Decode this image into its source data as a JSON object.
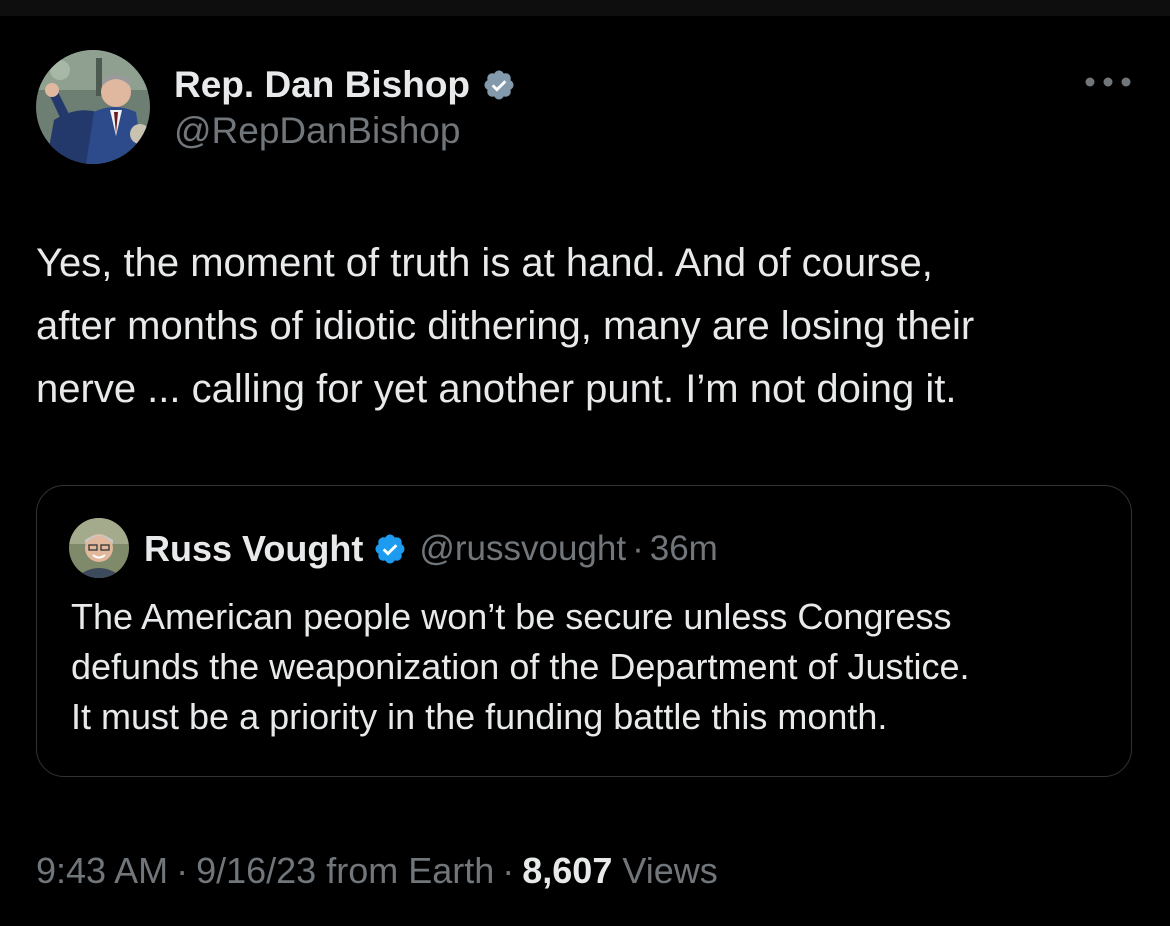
{
  "author": {
    "name": "Rep. Dan Bishop",
    "handle": "@RepDanBishop",
    "verified_badge": "gray-verified-badge-icon",
    "badge_color": "#829aab"
  },
  "tweet": {
    "text": "Yes, the moment of truth is at hand. And of course,\nafter months of idiotic dithering, many are losing their\nnerve ... calling for yet another punt. I’m not doing it."
  },
  "quote": {
    "name": "Russ Vought",
    "handle": "@russvought",
    "separator": "·",
    "time": "36m",
    "verified_badge": "blue-verified-badge-icon",
    "badge_color": "#1d9bf0",
    "text": "The American people won’t be secure unless Congress\ndefunds the weaponization of the Department of Justice.\nIt must be a priority in the funding battle this month."
  },
  "meta": {
    "time": "9:43 AM",
    "separator": "·",
    "date_source": "9/16/23 from Earth",
    "views_count": "8,607",
    "views_label": "Views"
  },
  "icons": {
    "more": "more-horizontal-icon"
  },
  "colors": {
    "background": "#000000",
    "text_primary": "#e7e9ea",
    "text_secondary": "#71767b",
    "border": "#2f3336"
  }
}
